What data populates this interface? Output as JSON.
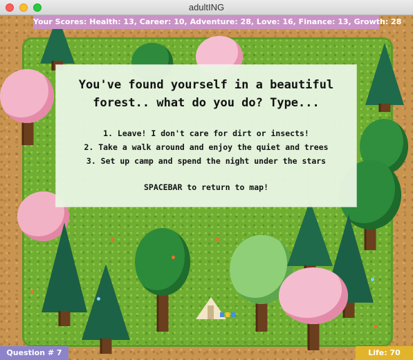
{
  "window": {
    "title": "adultING"
  },
  "scoreboard": {
    "text": "Your Scores: Health: 13, Career: 10, Adventure: 28, Love: 16, Finance: 13, Growth: 28"
  },
  "dialog": {
    "prompt_line1": "You've found yourself in a beautiful",
    "prompt_line2": "forest.. what do you do? Type...",
    "options": [
      "1. Leave! I don't care for dirt or insects!",
      "2. Take a walk around and enjoy the quiet and trees",
      "3. Set up camp and spend the night under the stars"
    ],
    "hint": "SPACEBAR to return to map!"
  },
  "footer": {
    "question": "Question # 7",
    "life": "Life: 70"
  },
  "colors": {
    "scoreboard_bg": "#c993c6",
    "question_bg": "#8c84ca",
    "life_bg": "#e2b42c",
    "grass": "#6fae33",
    "dirt": "#c9944f"
  },
  "icons": [
    "close-button",
    "minimize-button",
    "zoom-button"
  ]
}
